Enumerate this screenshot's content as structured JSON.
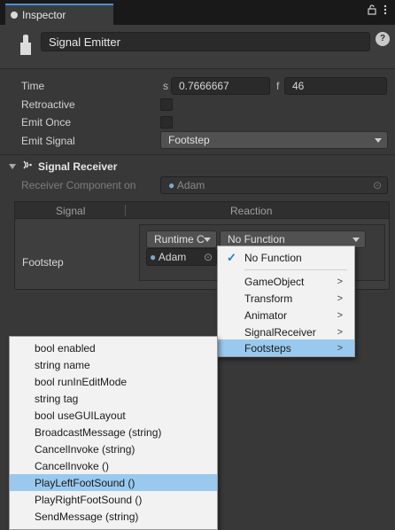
{
  "window": {
    "tab_title": "Inspector",
    "lock_icon": "lock-icon",
    "menu_icon": "vertical-dots-icon"
  },
  "header": {
    "object_name": "Signal Emitter",
    "object_icon": "signal-emitter-icon",
    "help_label": "?"
  },
  "emitter": {
    "time_label": "Time",
    "time_seconds_prefix": "s",
    "time_seconds": "0.7666667",
    "time_frames_prefix": "f",
    "time_frames": "46",
    "retroactive_label": "Retroactive",
    "retroactive_checked": false,
    "emit_once_label": "Emit Once",
    "emit_once_checked": false,
    "emit_signal_label": "Emit Signal",
    "emit_signal_value": "Footstep"
  },
  "receiver": {
    "component_title": "Signal Receiver",
    "receiver_component_label": "Receiver Component on",
    "receiver_component_value": "Adam",
    "col_signal": "Signal",
    "col_reaction": "Reaction",
    "row_signal": "Footstep",
    "runtime_label": "Runtime C",
    "function_value": "No Function",
    "object_value": "Adam"
  },
  "function_menu": {
    "no_function": "No Function",
    "items": [
      "GameObject",
      "Transform",
      "Animator",
      "SignalReceiver",
      "Footsteps"
    ],
    "highlighted": "Footsteps"
  },
  "method_menu": {
    "items": [
      "bool enabled",
      "string name",
      "bool runInEditMode",
      "string tag",
      "bool useGUILayout",
      "BroadcastMessage (string)",
      "CancelInvoke (string)",
      "CancelInvoke ()",
      "PlayLeftFootSound ()",
      "PlayRightFootSound ()",
      "SendMessage (string)"
    ],
    "highlighted": "PlayLeftFootSound ()"
  },
  "colors": {
    "panel_bg": "#383838",
    "tab_accent": "#4d8dd6",
    "menu_highlight": "#99c9ef",
    "check_blue": "#2a73d6"
  }
}
